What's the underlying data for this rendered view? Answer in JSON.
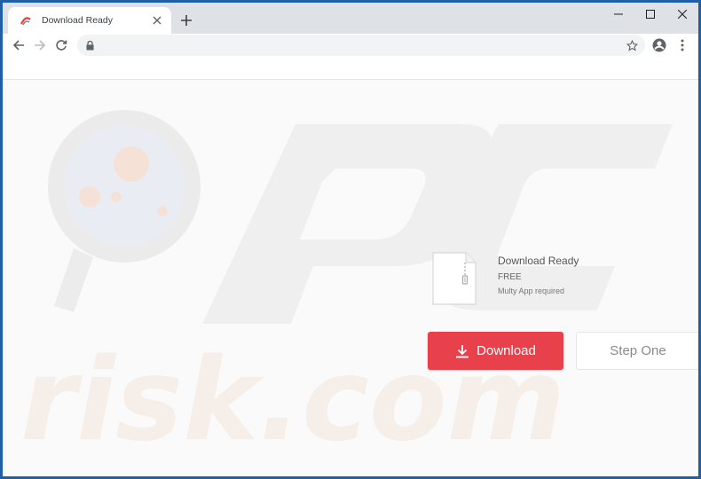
{
  "browser": {
    "tab": {
      "title": "Download Ready"
    },
    "address": {
      "url": ""
    }
  },
  "page": {
    "file": {
      "title": "Download Ready",
      "price": "FREE",
      "requirement": "Multy App required"
    },
    "buttons": {
      "download_label": "Download",
      "step_label": "Step One"
    },
    "watermark_text": "risk.com"
  },
  "colors": {
    "download_button": "#e8414b",
    "page_background": "#fafafa",
    "window_border": "#1e5fa8"
  }
}
